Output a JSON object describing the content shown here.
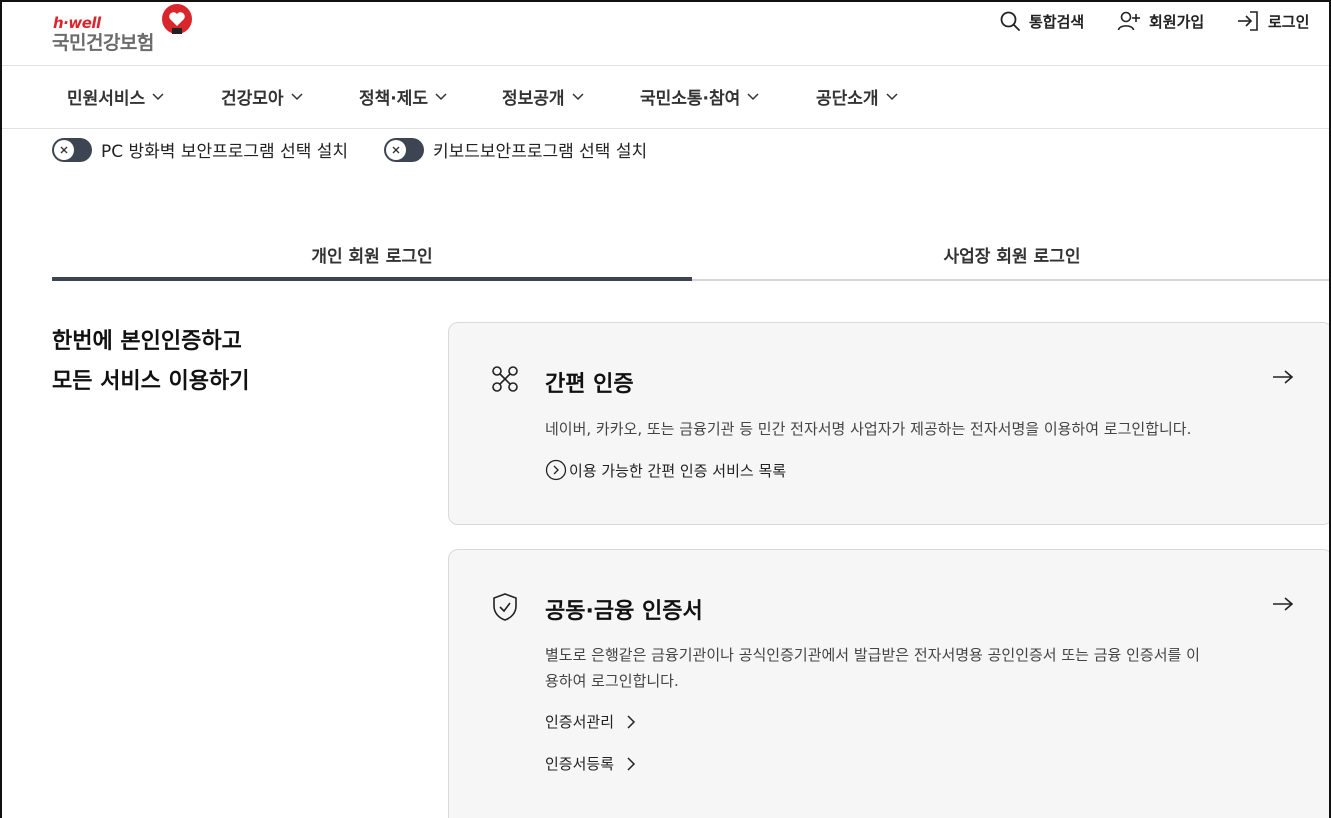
{
  "header": {
    "logo_sub": "h·well",
    "logo_main": "국민건강보험",
    "search_label": "통합검색",
    "join_label": "회원가입",
    "login_label": "로그인"
  },
  "gnb": {
    "items": [
      "민원서비스",
      "건강모아",
      "정책·제도",
      "정보공개",
      "국민소통·참여",
      "공단소개"
    ]
  },
  "security": {
    "firewall_label": "PC 방화벽 보안프로그램 선택 설치",
    "keyboard_label": "키보드보안프로그램 선택 설치"
  },
  "tabs": {
    "personal": "개인 회원 로그인",
    "business": "사업장 회원 로그인",
    "active": "personal"
  },
  "intro": {
    "line1": "한번에 본인인증하고",
    "line2": "모든 서비스 이용하기"
  },
  "simple_auth": {
    "title": "간편 인증",
    "description": "네이버, 카카오, 또는 금융기관 등 민간 전자서명 사업자가 제공하는 전자서명을 이용하여 로그인합니다.",
    "link": "이용 가능한 간편 인증 서비스 목록"
  },
  "cert_auth": {
    "title": "공동·금융 인증서",
    "description_line1": "별도로 은행같은 금융기관이나 공식인증기관에서 발급받은 전자서명용 공인인증서 또는 금융 인증서를 이",
    "description_line2": "용하여 로그인합니다.",
    "link_manage": "인증서관리",
    "link_register": "인증서등록"
  },
  "colors": {
    "brand_red": "#d9262c",
    "toggle_dark": "#3d4452",
    "card_bg": "#f6f6f6"
  }
}
